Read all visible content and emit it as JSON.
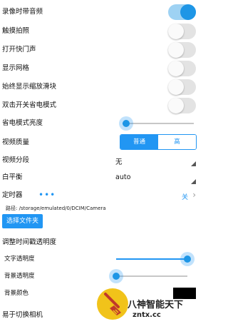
{
  "settings": {
    "record_audio": {
      "label": "录像时带音频",
      "on": true
    },
    "touch_capture": {
      "label": "触摸拍照",
      "on": false
    },
    "shutter_sound": {
      "label": "打开快门声",
      "on": false
    },
    "show_grid": {
      "label": "显示网格",
      "on": false
    },
    "always_zoom_slider": {
      "label": "始终显示缩放滑块",
      "on": false
    },
    "double_tap_power_save": {
      "label": "双击开关省电模式",
      "on": false
    },
    "power_save_brightness": {
      "label": "省电模式亮度",
      "value": 0.05
    },
    "video_quality": {
      "label": "视频质量",
      "options": [
        "普通",
        "高"
      ],
      "selected": "普通"
    },
    "video_segment": {
      "label": "视频分段",
      "value": "无"
    },
    "white_balance": {
      "label": "白平衡",
      "value": "auto"
    },
    "timer": {
      "label": "定时器",
      "value": "关",
      "dots": "•••"
    },
    "path": {
      "text": "路径: /storage/emulated/0/DCIM/Camera"
    },
    "choose_folder": {
      "label": "选择文件夹"
    },
    "timestamp_opacity": {
      "label": "调整时间戳透明度"
    },
    "text_opacity": {
      "label": "文字透明度",
      "value": 1.0
    },
    "bg_opacity": {
      "label": "背景透明度",
      "value": 0.0
    },
    "bg_color": {
      "label": "背景颜色",
      "value": "#000000"
    },
    "switch_camera": {
      "label": "易于切换相机"
    }
  },
  "watermark": {
    "line1": "八神智能天下",
    "line2": "zntx.cc",
    "logo": "broom-icon"
  },
  "colors": {
    "accent": "#2196f3",
    "toggle_on": "#1e96e6",
    "toggle_off": "#e3e3e3"
  }
}
